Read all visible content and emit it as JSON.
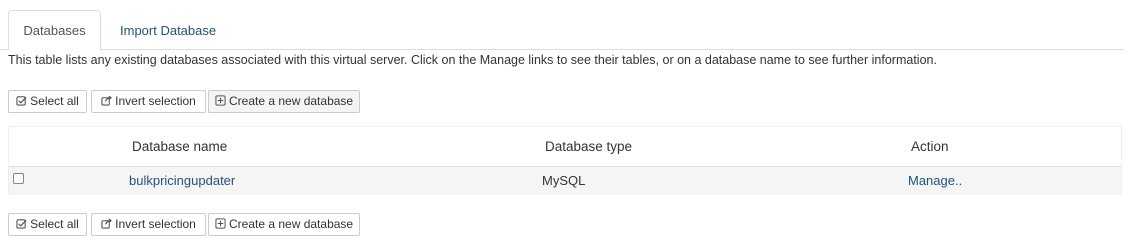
{
  "tabs": [
    {
      "label": "Databases",
      "active": true
    },
    {
      "label": "Import Database",
      "active": false
    }
  ],
  "intro_text": "This table lists any existing databases associated with this virtual server. Click on the Manage links to see their tables, or on a database name to see further information.",
  "toolbar": {
    "select_all": "Select all",
    "invert_selection": "Invert selection",
    "create_db": "Create a new database"
  },
  "table": {
    "columns": [
      "Database name",
      "Database type",
      "Action"
    ],
    "rows": [
      {
        "name": "bulkpricingupdater",
        "type": "MySQL",
        "action": "Manage..",
        "checked": false
      }
    ]
  },
  "colors": {
    "link": "#23527c",
    "row_bg": "#f5f5f5",
    "border": "#dddddd"
  }
}
